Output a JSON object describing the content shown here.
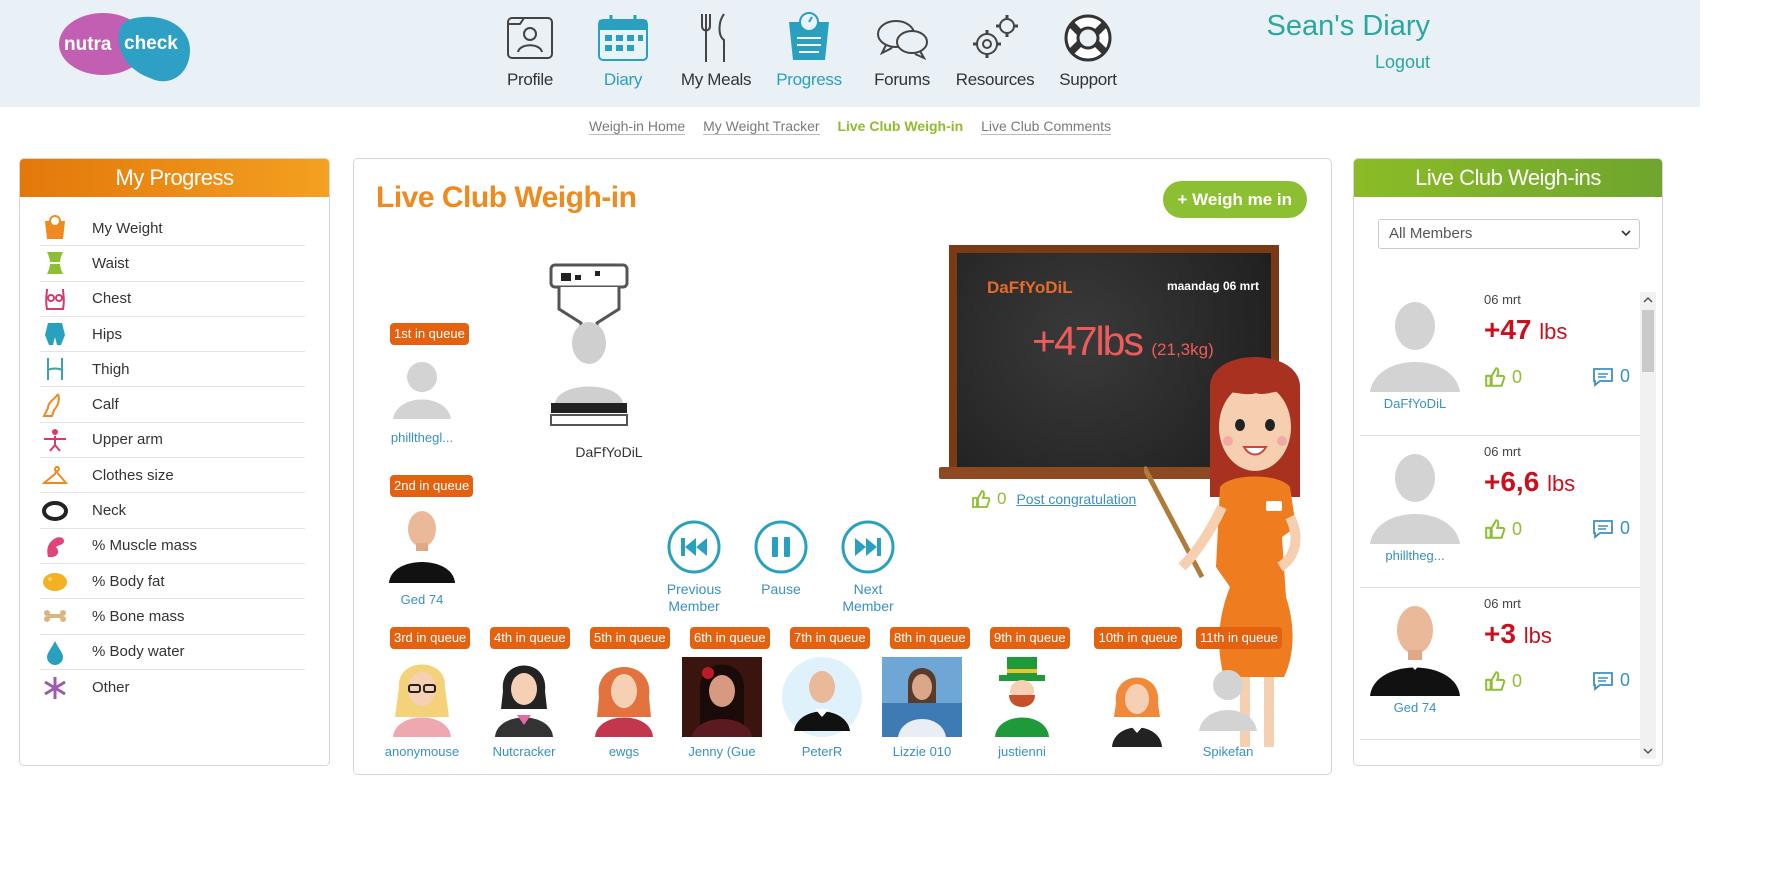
{
  "header": {
    "logo_text": "nutra check",
    "nav": [
      {
        "label": "Profile",
        "icon": "profile-icon"
      },
      {
        "label": "Diary",
        "icon": "calendar-icon"
      },
      {
        "label": "My Meals",
        "icon": "cutlery-icon"
      },
      {
        "label": "Progress",
        "icon": "scale-icon"
      },
      {
        "label": "Forums",
        "icon": "chat-bubbles-icon"
      },
      {
        "label": "Resources",
        "icon": "gears-icon"
      },
      {
        "label": "Support",
        "icon": "lifebuoy-icon"
      }
    ],
    "user_title": "Sean's Diary",
    "logout": "Logout"
  },
  "subnav": {
    "items": [
      "Weigh-in Home",
      "My Weight Tracker",
      "Live Club Weigh-in",
      "Live Club Comments"
    ],
    "active": "Live Club Weigh-in"
  },
  "progress_panel": {
    "title": "My Progress",
    "items": [
      "My Weight",
      "Waist",
      "Chest",
      "Hips",
      "Thigh",
      "Calf",
      "Upper arm",
      "Clothes size",
      "Neck",
      "% Muscle mass",
      "% Body fat",
      "% Bone mass",
      "% Body water",
      "Other"
    ]
  },
  "weighin": {
    "title": "Live Club Weigh-in",
    "weigh_button": "+ Weigh me in",
    "on_scale": "DaFfYoDiL",
    "queue": [
      {
        "badge": "1st in queue",
        "name": "phillthegl..."
      },
      {
        "badge": "2nd in queue",
        "name": "Ged 74"
      },
      {
        "badge": "3rd in queue",
        "name": "anonymouse"
      },
      {
        "badge": "4th in queue",
        "name": "Nutcracker"
      },
      {
        "badge": "5th in queue",
        "name": "ewgs"
      },
      {
        "badge": "6th in queue",
        "name": "Jenny (Gue"
      },
      {
        "badge": "7th in queue",
        "name": "PeterR"
      },
      {
        "badge": "8th in queue",
        "name": "Lizzie 010"
      },
      {
        "badge": "9th in queue",
        "name": "justienni"
      },
      {
        "badge": "10th in queue",
        "name": ""
      },
      {
        "badge": "11th in queue",
        "name": "Spikefan"
      }
    ],
    "board": {
      "name": "DaFfYoDiL",
      "date": "maandag 06 mrt",
      "value": "+47lbs",
      "kg": "(21,3kg)"
    },
    "congrats_count": "0",
    "congrats_link": "Post congratulation",
    "controls": {
      "previous": "Previous Member",
      "pause": "Pause",
      "next": "Next Member"
    }
  },
  "club_panel": {
    "title": "Live Club Weigh-ins",
    "filter": "All Members",
    "feed": [
      {
        "date": "06 mrt",
        "weight": "+47",
        "unit": "lbs",
        "name": "DaFfYoDiL",
        "likes": "0",
        "comments": "0"
      },
      {
        "date": "06 mrt",
        "weight": "+6,6",
        "unit": "lbs",
        "name": "philltheg...",
        "likes": "0",
        "comments": "0"
      },
      {
        "date": "06 mrt",
        "weight": "+3",
        "unit": "lbs",
        "name": "Ged 74",
        "likes": "0",
        "comments": "0"
      }
    ]
  },
  "colors": {
    "accent_orange": "#ee8a1e",
    "accent_green": "#8dbf32",
    "link_blue": "#3a90c0",
    "weight_red": "#c8101e"
  }
}
